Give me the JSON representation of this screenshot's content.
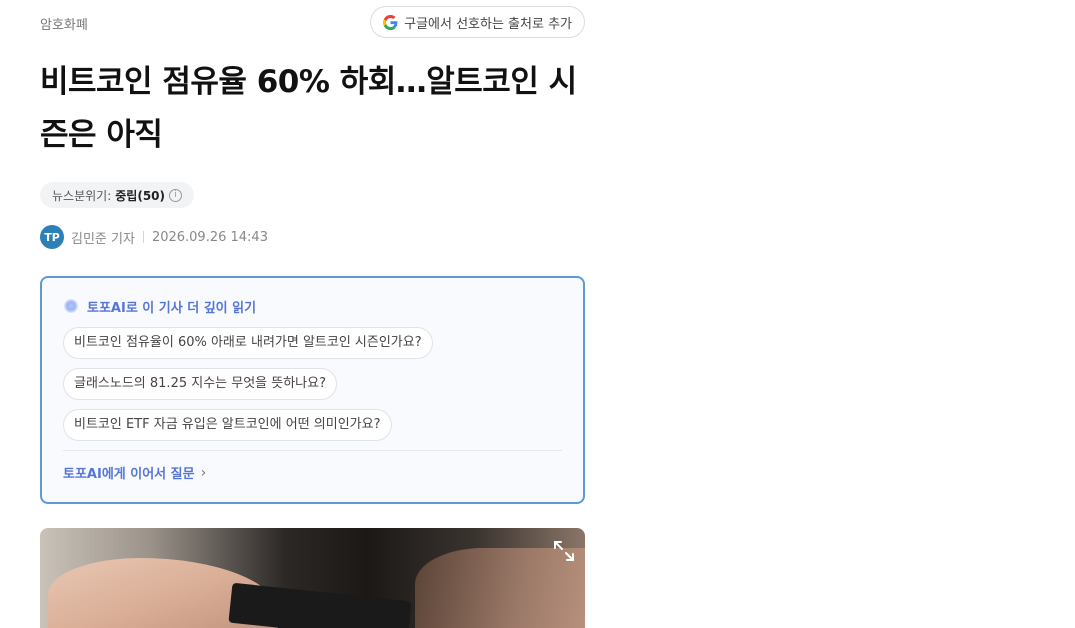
{
  "header": {
    "category": "암호화폐",
    "google_button_label": "구글에서 선호하는 출처로 추가"
  },
  "article": {
    "title": "비트코인 점유율 60% 하회…알트코인 시즌은 아직",
    "mood_label": "뉴스분위기:",
    "mood_value": "중립(50)",
    "info_glyph": "i",
    "author_initials": "TP",
    "author": "김민준 기자",
    "date": "2026.09.26 14:43"
  },
  "ai_panel": {
    "heading": "토포AI로 이 기사 더 깊이 읽기",
    "questions": [
      "비트코인 점유율이 60% 아래로 내려가면 알트코인 시즌인가요?",
      "글래스노드의 81.25 지수는 무엇을 뜻하나요?",
      "비트코인 ETF 자금 유입은 알트코인에 어떤 의미인가요?"
    ],
    "follow_up": "토포AI에게 이어서 질문",
    "follow_glyph": "›"
  },
  "icons": {
    "google": "google-g-icon",
    "info": "info-icon",
    "ai": "ai-orb-icon",
    "chevron": "chevron-right-icon",
    "expand": "expand-icon"
  },
  "colors": {
    "ai_accent": "#5575d8",
    "ai_border": "#5b9bd5",
    "avatar_bg": "#2d7fb8"
  }
}
